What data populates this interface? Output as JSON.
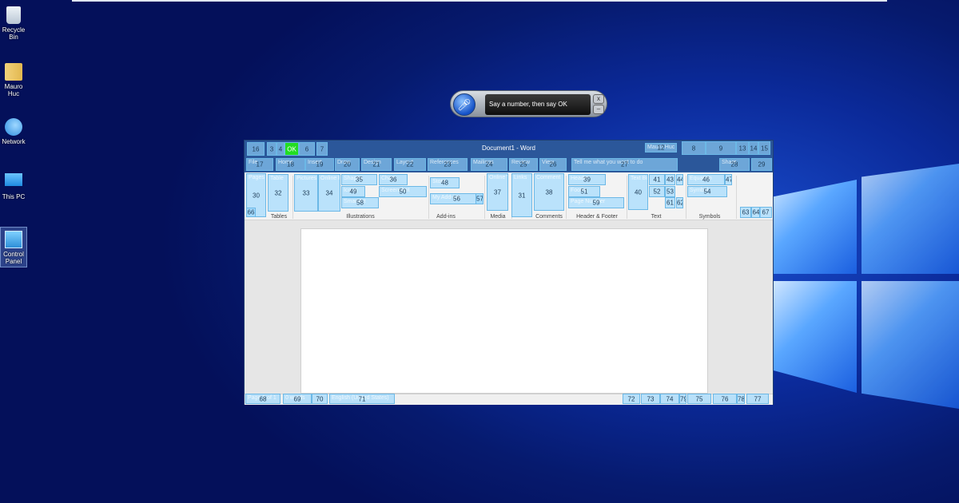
{
  "desktop": {
    "icons": [
      {
        "label": "Recycle Bin",
        "icon": "recycle-bin-icon"
      },
      {
        "label": "Mauro Huc",
        "icon": "user-folder-icon"
      },
      {
        "label": "Network",
        "icon": "network-icon"
      },
      {
        "label": "This PC",
        "icon": "computer-icon"
      },
      {
        "label": "Control Panel",
        "icon": "control-panel-icon",
        "selected": true
      }
    ]
  },
  "speech": {
    "prompt": "Say a number, then say OK",
    "close": "x",
    "minimize": "–"
  },
  "word": {
    "title": "Document1  -  Word",
    "group_labels": [
      "Tables",
      "Illustrations",
      "Add-ins",
      "Media",
      "Comments",
      "Header & Footer",
      "Text",
      "Symbols"
    ]
  },
  "overlays": [
    {
      "n": "16",
      "u": ""
    },
    {
      "n": "3",
      "u": ""
    },
    {
      "n": "4",
      "u": ""
    },
    {
      "n": "OK",
      "u": ""
    },
    {
      "n": "6",
      "u": ""
    },
    {
      "n": "7",
      "u": ""
    },
    {
      "n": "12",
      "u": "Mauro Huc"
    },
    {
      "n": "8",
      "u": ""
    },
    {
      "n": "9",
      "u": ""
    },
    {
      "n": "13",
      "u": ""
    },
    {
      "n": "14",
      "u": ""
    },
    {
      "n": "15",
      "u": ""
    },
    {
      "n": "17",
      "u": "File"
    },
    {
      "n": "18",
      "u": "Home"
    },
    {
      "n": "19",
      "u": "Insert"
    },
    {
      "n": "20",
      "u": "Draw"
    },
    {
      "n": "21",
      "u": "Design"
    },
    {
      "n": "22",
      "u": "Layout"
    },
    {
      "n": "23",
      "u": "References"
    },
    {
      "n": "24",
      "u": "Mailings"
    },
    {
      "n": "25",
      "u": "Review"
    },
    {
      "n": "26",
      "u": "View"
    },
    {
      "n": "27",
      "u": "Tell me what you want to do"
    },
    {
      "n": "28",
      "u": "Share"
    },
    {
      "n": "29",
      "u": ""
    },
    {
      "n": "30",
      "u": "Pages"
    },
    {
      "n": "66",
      "u": ""
    },
    {
      "n": "32",
      "u": "Table"
    },
    {
      "n": "33",
      "u": "Pictures"
    },
    {
      "n": "34",
      "u": "Online Pictures"
    },
    {
      "n": "35",
      "u": "Shapes"
    },
    {
      "n": "49",
      "u": "Icons"
    },
    {
      "n": "58",
      "u": "SmartArt"
    },
    {
      "n": "36",
      "u": "Chart"
    },
    {
      "n": "50",
      "u": "Screenshot"
    },
    {
      "n": "48",
      "u": "Store"
    },
    {
      "n": "56",
      "u": "My Add-ins"
    },
    {
      "n": "57",
      "u": ""
    },
    {
      "n": "37",
      "u": "Online Video"
    },
    {
      "n": "31",
      "u": "Links"
    },
    {
      "n": "38",
      "u": "Comment"
    },
    {
      "n": "39",
      "u": "Header"
    },
    {
      "n": "51",
      "u": "Footer"
    },
    {
      "n": "59",
      "u": "Page Number"
    },
    {
      "n": "40",
      "u": "Text Box"
    },
    {
      "n": "41",
      "u": ""
    },
    {
      "n": "43",
      "u": ""
    },
    {
      "n": "44",
      "u": ""
    },
    {
      "n": "52",
      "u": ""
    },
    {
      "n": "53",
      "u": ""
    },
    {
      "n": "61",
      "u": ""
    },
    {
      "n": "62",
      "u": ""
    },
    {
      "n": "46",
      "u": "Equation"
    },
    {
      "n": "47",
      "u": ""
    },
    {
      "n": "54",
      "u": "Symbol"
    },
    {
      "n": "63",
      "u": ""
    },
    {
      "n": "64",
      "u": ""
    },
    {
      "n": "67",
      "u": ""
    },
    {
      "n": "68",
      "u": "Page 1 of 1"
    },
    {
      "n": "69",
      "u": "0 words"
    },
    {
      "n": "70",
      "u": ""
    },
    {
      "n": "71",
      "u": "English (United States)"
    },
    {
      "n": "72",
      "u": ""
    },
    {
      "n": "73",
      "u": ""
    },
    {
      "n": "74",
      "u": ""
    },
    {
      "n": "79",
      "u": ""
    },
    {
      "n": "75",
      "u": ""
    },
    {
      "n": "76",
      "u": ""
    },
    {
      "n": "78",
      "u": ""
    },
    {
      "n": "77",
      "u": ""
    }
  ],
  "colors": {
    "word_blue": "#2b579a",
    "overlay": "#96d7ff",
    "ok": "#22dd22"
  }
}
